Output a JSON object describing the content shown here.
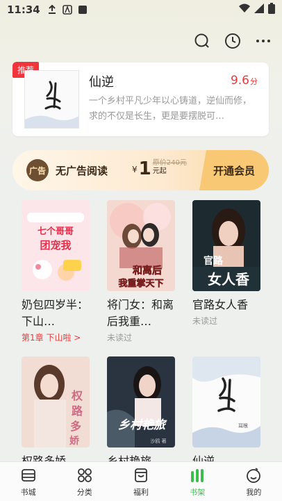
{
  "status_bar": {
    "time": "11:34"
  },
  "featured": {
    "badge": "推荐",
    "title": "仙逆",
    "score": "9.6",
    "score_unit": "分",
    "description": "一个乡村平凡少年以心铸道，逆仙而修，求的不仅是长生，更是要摆脱可…"
  },
  "ad_banner": {
    "label": "无广告阅读",
    "currency": "¥",
    "price": "1",
    "original_price": "原价240元",
    "price_suffix": "元起",
    "cta": "开通会员"
  },
  "books": [
    {
      "title": "奶包四岁半：下山…",
      "sub": "第1章 下山啦 >",
      "cover_text": "七个哥哥团宠我"
    },
    {
      "title": "将门女：和离后我重…",
      "sub": "未读过",
      "cover_text": "和离后我重掌天下"
    },
    {
      "title": "官路女人香",
      "sub": "未读过",
      "cover_text": "官路女人香"
    },
    {
      "title": "权路多娇",
      "sub": "",
      "cover_text": "权路多娇"
    },
    {
      "title": "乡村艳旅",
      "sub": "",
      "cover_text": "乡村艳旅"
    },
    {
      "title": "仙逆",
      "sub": "",
      "cover_text": "仙逆"
    }
  ],
  "tabs": [
    {
      "label": "书城",
      "icon": "bookstore-icon"
    },
    {
      "label": "分类",
      "icon": "category-icon"
    },
    {
      "label": "福利",
      "icon": "gift-icon"
    },
    {
      "label": "书架",
      "icon": "bookshelf-icon",
      "active": true
    },
    {
      "label": "我的",
      "icon": "profile-icon"
    }
  ],
  "colors": {
    "accent": "#3cbd4e",
    "red": "#e83a3a",
    "vip_gold": "#f8c874"
  }
}
